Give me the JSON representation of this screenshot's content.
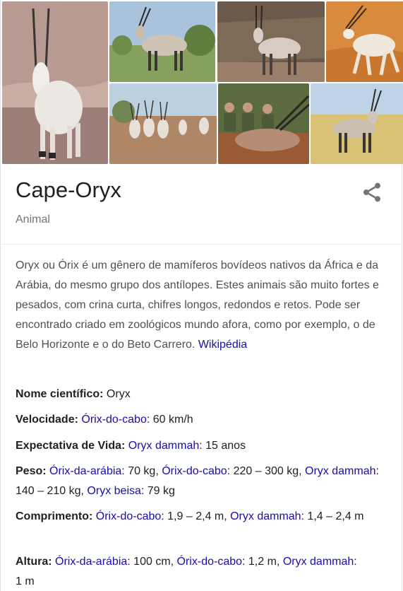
{
  "images": [
    {
      "name": "white-oryx-photo",
      "alt": ""
    },
    {
      "name": "oryx-grassland-photo",
      "alt": ""
    },
    {
      "name": "oryx-bushland-photo",
      "alt": ""
    },
    {
      "name": "white-oryx-desert-photo",
      "alt": ""
    },
    {
      "name": "oryx-herd-photo",
      "alt": ""
    },
    {
      "name": "hunters-oryx-photo",
      "alt": ""
    },
    {
      "name": "oryx-savanna-photo",
      "alt": ""
    }
  ],
  "header": {
    "title": "Cape-Oryx",
    "subtitle": "Animal"
  },
  "description": {
    "text": "Oryx ou Órix é um gênero de mamíferos bovídeos nativos da África e da Arábia, do mesmo grupo dos antílopes. Estes animais são muito fortes e pesados, com crina curta, chifres longos, redondos e retos. Pode ser encontrado criado em zoológicos mundo afora, como por exemplo, o de Belo Horizonte e o do Beto Carrero.",
    "source": "Wikipédia"
  },
  "facts": {
    "scientific_name": {
      "label": "Nome científico:",
      "value": " Oryx"
    },
    "speed": {
      "label": "Velocidade:",
      "link1": "Órix-do-cabo",
      "text1": ": 60 km/h"
    },
    "life_expectancy": {
      "label": "Expectativa de Vida:",
      "link1": "Oryx dammah",
      "text1": ": 15 anos"
    },
    "weight": {
      "label": "Peso:",
      "link1": "Órix-da-arábia",
      "text1": ": 70 kg, ",
      "link2": "Órix-do-cabo",
      "text2": ": 220 – 300 kg, ",
      "link3": "Oryx dammah",
      "text3": ": 140 – 210 kg, ",
      "link4": "Oryx beisa",
      "text4": ": 79 kg"
    },
    "length": {
      "label": "Comprimento:",
      "link1": "Órix-do-cabo",
      "text1": ": 1,9 – 2,4 m, ",
      "link2": "Oryx dammah",
      "text2": ": 1,4 – 2,4 m"
    },
    "height": {
      "label": "Altura:",
      "link1": "Órix-da-arábia",
      "text1": ": 100 cm, ",
      "link2": "Órix-do-cabo",
      "text2": ": 1,2 m, ",
      "link3": "Oryx dammah",
      "text3": ":",
      "text4": "1 m"
    }
  },
  "colors": {
    "link": "#1a0dab",
    "title": "#202124",
    "muted": "#70757a",
    "body": "#4d5156",
    "share_icon": "#70757a"
  }
}
